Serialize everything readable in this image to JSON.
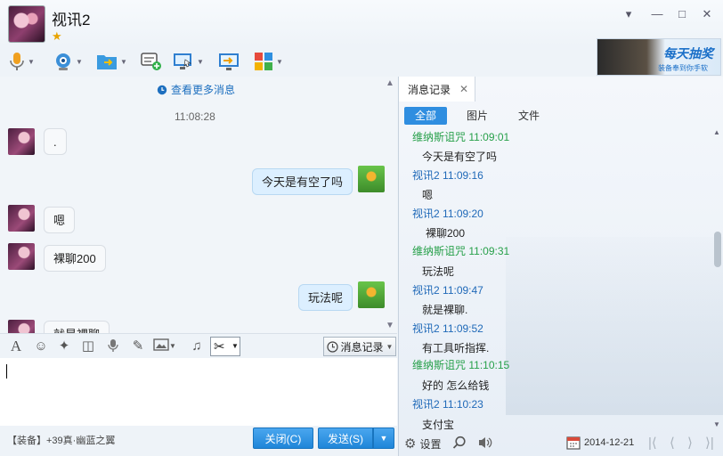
{
  "window": {
    "title": "视讯2",
    "star": "★"
  },
  "chat": {
    "more_link": "查看更多消息",
    "time": "11:08:28",
    "messages": [
      {
        "from": "other",
        "text": "."
      },
      {
        "from": "self",
        "text": "今天是有空了吗"
      },
      {
        "from": "other",
        "text": "嗯"
      },
      {
        "from": "other",
        "text": "裸聊200"
      },
      {
        "from": "self",
        "text": "玩法呢"
      },
      {
        "from": "other",
        "text": "就是裸聊"
      }
    ]
  },
  "input_toolbar": {
    "history_label": "消息记录"
  },
  "bottom": {
    "ad_line": "【装备】+39真·幽蓝之翼",
    "close_label": "关闭(C)",
    "send_label": "发送(S)"
  },
  "ad": {
    "title": "每天抽奖",
    "subtitle": "装备奉到你手软"
  },
  "history": {
    "tab_label": "消息记录",
    "filters": [
      "全部",
      "图片",
      "文件"
    ],
    "entries": [
      {
        "sender": "维纳斯诅咒",
        "time": "11:09:01",
        "text": "今天是有空了吗",
        "kind": "other"
      },
      {
        "sender": "视讯2",
        "time": "11:09:16",
        "text": "嗯",
        "kind": "self"
      },
      {
        "sender": "视讯2",
        "time": "11:09:20",
        "text": "裸聊200",
        "kind": "self"
      },
      {
        "sender": "维纳斯诅咒",
        "time": "11:09:31",
        "text": "玩法呢",
        "kind": "other"
      },
      {
        "sender": "视讯2",
        "time": "11:09:47",
        "text": "就是裸聊.",
        "kind": "self"
      },
      {
        "sender": "视讯2",
        "time": "11:09:52",
        "text": "有工具听指挥.",
        "kind": "self"
      },
      {
        "sender": "维纳斯诅咒",
        "time": "11:10:15",
        "text": "好的 怎么给钱",
        "kind": "other"
      },
      {
        "sender": "视讯2",
        "time": "11:10:23",
        "text": "支付宝",
        "kind": "self"
      }
    ],
    "settings_label": "设置",
    "date": "2014-12-21"
  }
}
